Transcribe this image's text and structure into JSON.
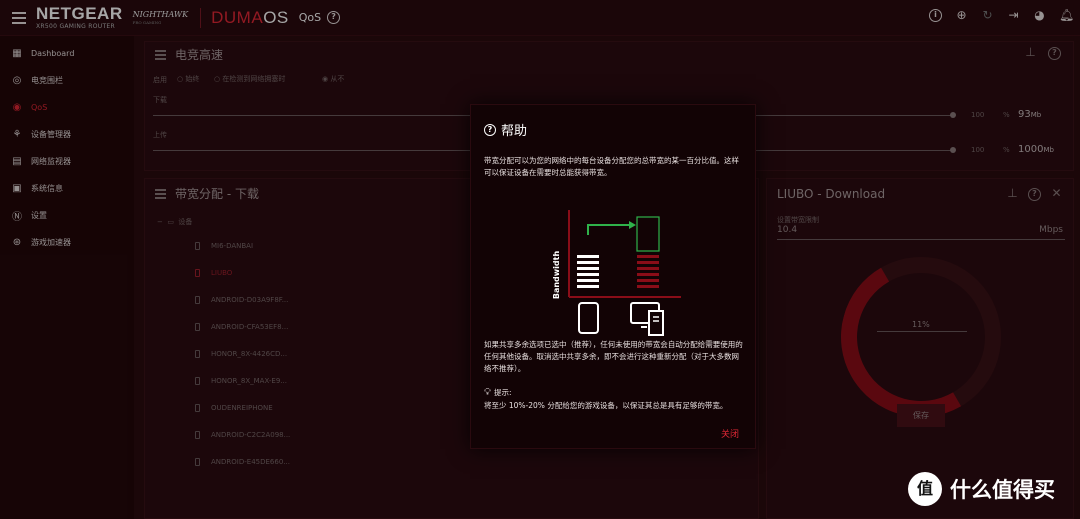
{
  "topbar": {
    "brand": "NETGEAR",
    "model": "XR500 GAMING ROUTER",
    "nighthawk": "NIGHTHAWK",
    "nighthawk_sub": "PRO GAMING",
    "os_red": "DUMA",
    "os_white": "OS",
    "page": "QoS"
  },
  "sidebar": {
    "items": [
      {
        "label": "Dashboard",
        "icon": "dashboard-icon"
      },
      {
        "label": "电竞围栏",
        "icon": "geofence-icon"
      },
      {
        "label": "QoS",
        "icon": "qos-icon"
      },
      {
        "label": "设备管理器",
        "icon": "device-manager-icon"
      },
      {
        "label": "网络监视器",
        "icon": "network-monitor-icon"
      },
      {
        "label": "系统信息",
        "icon": "system-info-icon"
      },
      {
        "label": "设置",
        "icon": "settings-icon"
      },
      {
        "label": "游戏加速器",
        "icon": "game-accelerator-icon"
      }
    ]
  },
  "bandwidth_card": {
    "title": "电竞高速",
    "enable_label": "启用",
    "opt_always": "始终",
    "opt_detect": "在检测到网络拥塞时",
    "opt_never": "从不",
    "download_label": "下载",
    "upload_label": "上传",
    "download_pct": "100",
    "upload_pct": "100",
    "pct_sign": "%",
    "download_value": "93",
    "download_unit": "Mb",
    "upload_value": "1000",
    "upload_unit": "Mb"
  },
  "allocation_card": {
    "title": "带宽分配 - 下载",
    "group_label": "设备",
    "devices": [
      "MI6-DANBAI",
      "LIUBO",
      "ANDROID-D03A9F8F...",
      "ANDROID-CFA53EF8...",
      "HONOR_8X-4426CD...",
      "HONOR_8X_MAX-E9...",
      "OUDENREIPHONE",
      "ANDROID-C2C2A098...",
      "ANDROID-E45DE660..."
    ]
  },
  "device_panel": {
    "title": "LIUBO - Download",
    "field_label": "设置带宽限制",
    "value": "10.4",
    "unit": "Mbps",
    "percent": "11%",
    "save_label": "保存",
    "percent_value": 0.11
  },
  "modal": {
    "title": "帮助",
    "para1": "带宽分配可以为您的网络中的每台设备分配您的总带宽的某一百分比值。这样可以保证设备在需要时总能获得带宽。",
    "axis_label": "Bandwidth",
    "para2": "如果共享多余选项已选中（推荐），任何未使用的带宽会自动分配给需要使用的任何其他设备。取消选中共享多余，即不会进行这种重新分配（对于大多数网络不推荐）。",
    "tip_title": "提示:",
    "tip_text": "将至少 10%-20% 分配给您的游戏设备，以保证其总是具有足够的带宽。",
    "close_label": "关闭"
  },
  "watermark": {
    "logo": "值",
    "text": "什么值得买"
  },
  "colors": {
    "accent": "#e02735",
    "background": "#1a0509",
    "modal_bg": "#120305",
    "arrow_green": "#2fb24a"
  }
}
